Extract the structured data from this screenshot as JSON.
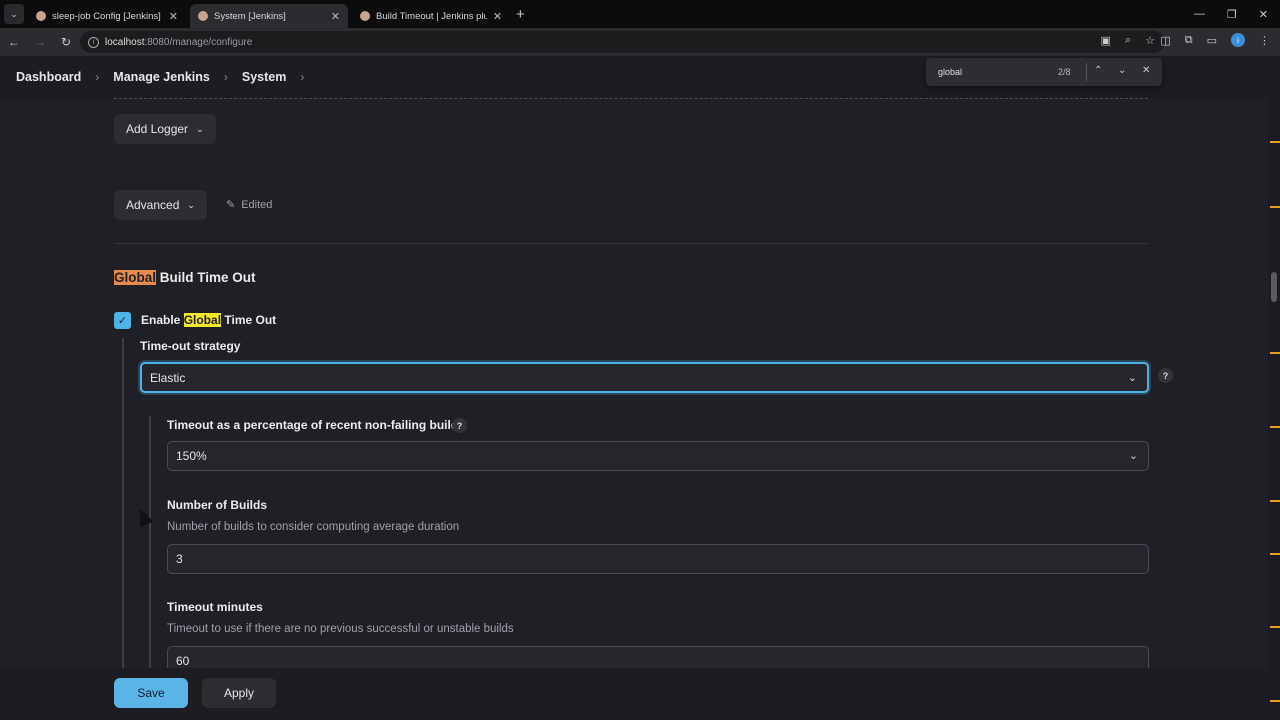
{
  "browser": {
    "tabs": [
      {
        "title": "sleep-job Config [Jenkins]",
        "active": false
      },
      {
        "title": "System [Jenkins]",
        "active": true
      },
      {
        "title": "Build Timeout | Jenkins plugin",
        "active": false
      }
    ],
    "url_host": "localhost",
    "url_rest": ":8080/manage/configure",
    "profile_initial": "i"
  },
  "find": {
    "query": "global",
    "count": "2/8"
  },
  "breadcrumb": [
    "Dashboard",
    "Manage Jenkins",
    "System"
  ],
  "content": {
    "add_logger_label": "Add Logger",
    "advanced_label": "Advanced",
    "edited_label": "Edited",
    "section_title_highlight": "Global",
    "section_title_rest": " Build Time Out",
    "enable_prefix": "Enable ",
    "enable_highlight": "Global",
    "enable_suffix": " Time Out",
    "enable_checked": true,
    "strategy_label": "Time-out strategy",
    "strategy_value": "Elastic",
    "percentage_label": "Timeout as a percentage of recent non-failing builds",
    "percentage_value": "150%",
    "num_builds_label": "Number of Builds",
    "num_builds_desc": "Number of builds to consider computing average duration",
    "num_builds_value": "3",
    "timeout_minutes_label": "Timeout minutes",
    "timeout_minutes_desc": "Timeout to use if there are no previous successful or unstable builds",
    "timeout_minutes_value": "60"
  },
  "actions": {
    "save_label": "Save",
    "apply_label": "Apply"
  },
  "colors": {
    "accent": "#4fb3e8",
    "find_current_highlight": "#e8894d",
    "find_highlight": "#f5e72c"
  }
}
